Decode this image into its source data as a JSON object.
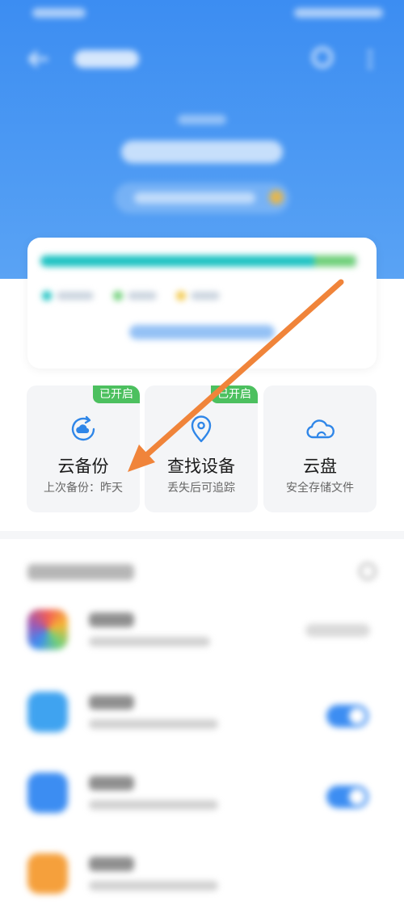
{
  "colors": {
    "header_blue": "#3c8df2",
    "badge_green": "#4cc05f",
    "icon_blue": "#2f86e8",
    "arrow_orange": "#f0843a"
  },
  "feature_cards": [
    {
      "title": "云备份",
      "subtitle": "上次备份：昨天",
      "badge": "已开启",
      "icon": "cloud-sync-icon"
    },
    {
      "title": "查找设备",
      "subtitle": "丢失后可追踪",
      "badge": "已开启",
      "icon": "location-pin-icon"
    },
    {
      "title": "云盘",
      "subtitle": "安全存储文件",
      "icon": "cloud-icon"
    }
  ]
}
